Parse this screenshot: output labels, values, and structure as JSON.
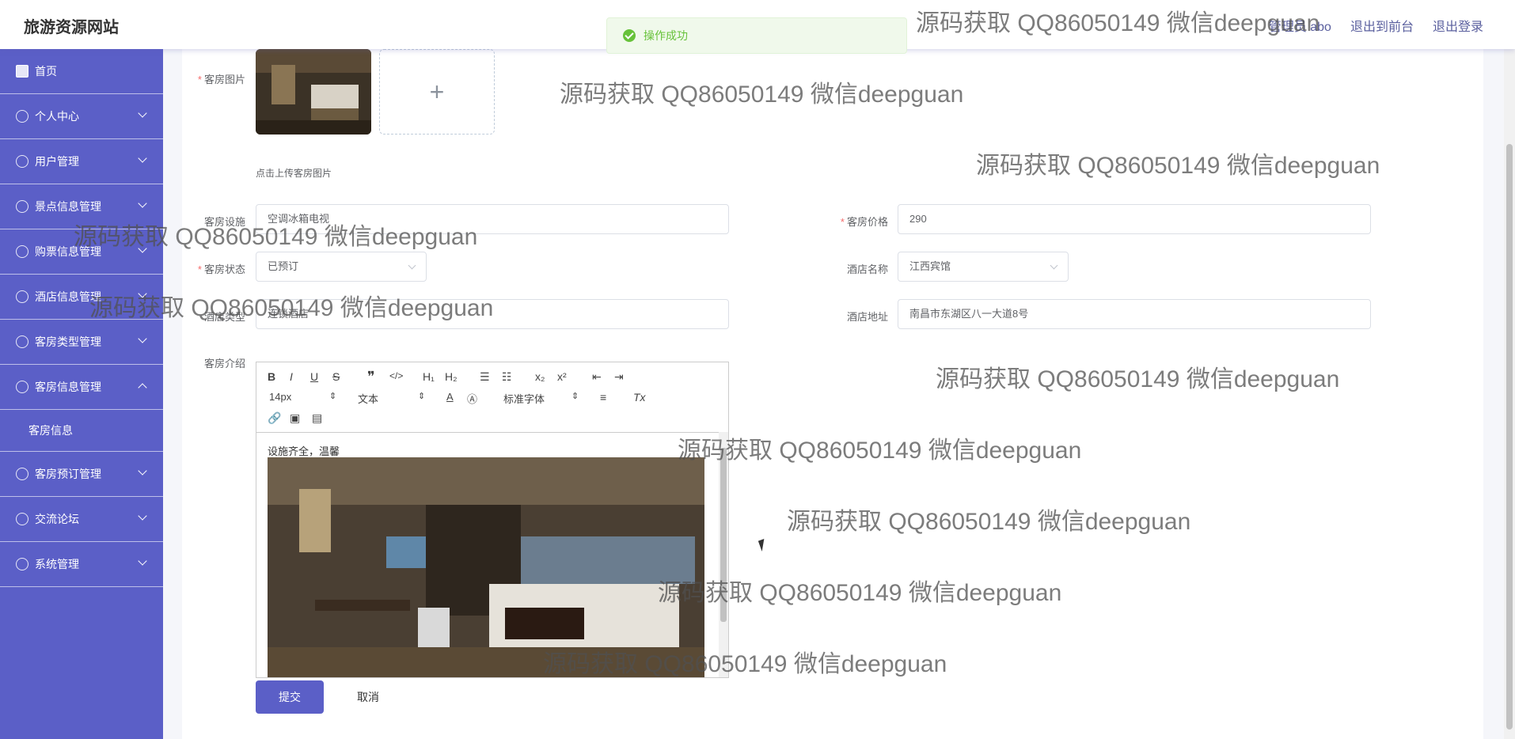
{
  "header": {
    "brand": "旅游资源网站",
    "user": "管理员 abo",
    "to_front": "退出到前台",
    "logout": "退出登录"
  },
  "toast": {
    "message": "操作成功",
    "icon": "check-circle-icon",
    "color": "#67c23a"
  },
  "sidebar": {
    "items": [
      {
        "label": "首页",
        "icon": "home-icon"
      },
      {
        "label": "个人中心",
        "icon": "user-icon"
      },
      {
        "label": "用户管理",
        "icon": "id-card-icon"
      },
      {
        "label": "景点信息管理",
        "icon": "plane-icon"
      },
      {
        "label": "购票信息管理",
        "icon": "power-icon"
      },
      {
        "label": "酒店信息管理",
        "icon": "bell-icon"
      },
      {
        "label": "客房类型管理",
        "icon": "crop-icon"
      },
      {
        "label": "客房信息管理",
        "icon": "user-icon"
      },
      {
        "label": "客房预订管理",
        "icon": "palette-icon"
      },
      {
        "label": "交流论坛",
        "icon": "copy-icon"
      },
      {
        "label": "系统管理",
        "icon": "globe-icon"
      }
    ],
    "sub_item": "客房信息",
    "color": "#5b5fc7"
  },
  "form": {
    "room_image_label": "客房图片",
    "upload_hint": "点击上传客房图片",
    "facilities_label": "客房设施",
    "facilities_value": "空调冰箱电视",
    "price_label": "客房价格",
    "price_value": "290",
    "status_label": "客房状态",
    "status_value": "已预订",
    "hotel_name_label": "酒店名称",
    "hotel_name_value": "江西宾馆",
    "hotel_type_label": "酒店类型",
    "hotel_type_value": "连锁酒店",
    "hotel_address_label": "酒店地址",
    "hotel_address_value": "南昌市东湖区八一大道8号",
    "intro_label": "客房介绍",
    "required_mark": "*"
  },
  "editor": {
    "font_size": "14px",
    "text_type": "文本",
    "font_family": "标准字体",
    "content_text": "设施齐全，温馨"
  },
  "buttons": {
    "submit": "提交",
    "cancel": "取消"
  },
  "watermark": "源码获取 QQ86050149 微信deepguan"
}
